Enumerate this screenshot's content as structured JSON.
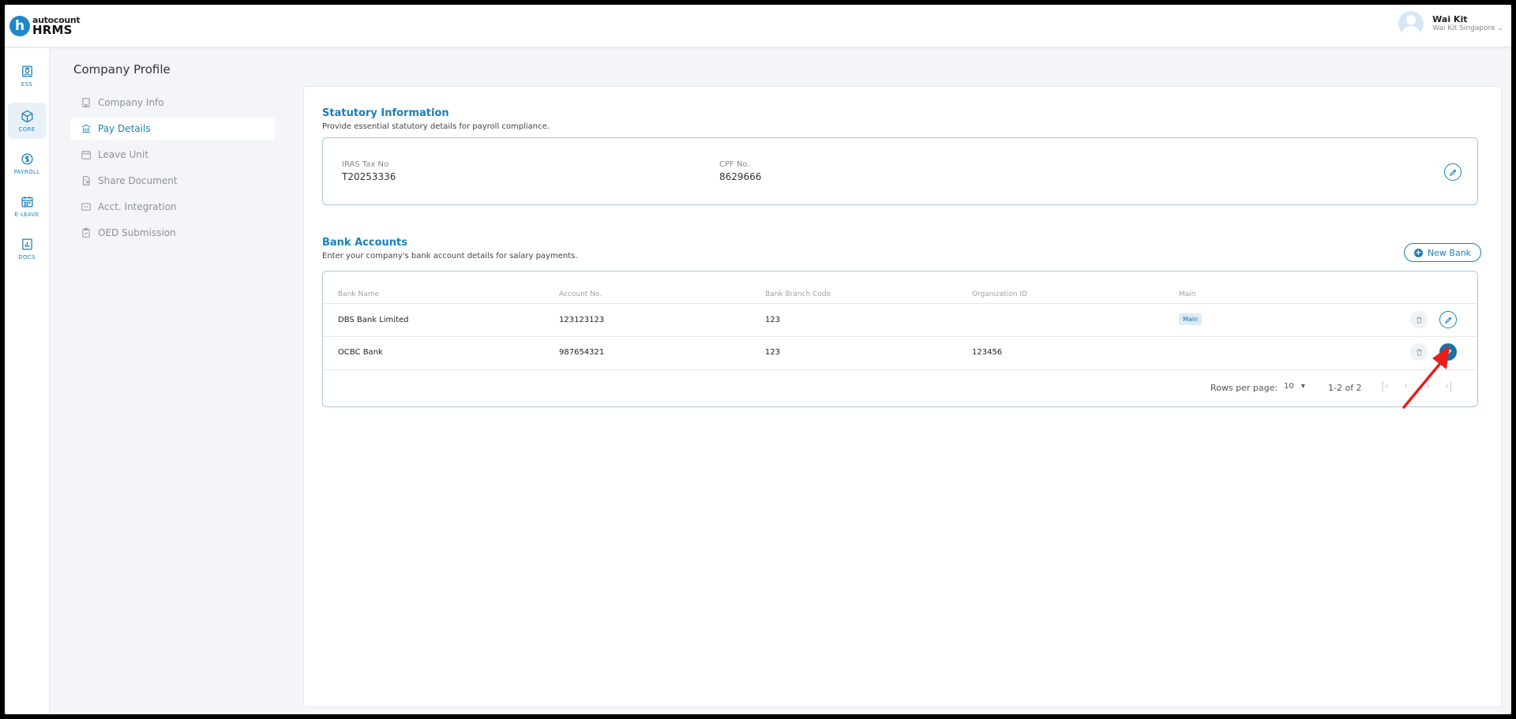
{
  "brand": {
    "logo_letter": "h",
    "logo_top": "autocount",
    "logo_bottom": "HRMS"
  },
  "user": {
    "name": "Wai Kit",
    "company": "Wai Kit Singapore"
  },
  "rail": [
    {
      "label": "ESS"
    },
    {
      "label": "CORE"
    },
    {
      "label": "PAYROLL"
    },
    {
      "label": "E-LEAVE"
    },
    {
      "label": "DOCS"
    }
  ],
  "page": {
    "title": "Company Profile"
  },
  "submenu": [
    {
      "label": "Company Info"
    },
    {
      "label": "Pay Details"
    },
    {
      "label": "Leave Unit"
    },
    {
      "label": "Share Document"
    },
    {
      "label": "Acct. Integration"
    },
    {
      "label": "OED Submission"
    }
  ],
  "statutory": {
    "title": "Statutory Information",
    "subtitle": "Provide essential statutory details for payroll compliance.",
    "iras_label": "IRAS Tax No",
    "iras_value": "T20253336",
    "cpf_label": "CPF No.",
    "cpf_value": "8629666"
  },
  "bank": {
    "title": "Bank Accounts",
    "subtitle": "Enter your company's bank account details for salary payments.",
    "new_button": "New Bank",
    "columns": [
      "Bank Name",
      "Account No.",
      "Bank Branch Code",
      "Organization ID",
      "Main"
    ],
    "rows": [
      {
        "bank_name": "DBS Bank Limited",
        "account_no": "123123123",
        "branch_code": "123",
        "org_id": "",
        "main": "Main"
      },
      {
        "bank_name": "OCBC Bank",
        "account_no": "987654321",
        "branch_code": "123",
        "org_id": "123456",
        "main": ""
      }
    ],
    "pagination": {
      "rows_per_page_label": "Rows per page:",
      "rows_per_page": "10",
      "range": "1-2 of 2"
    }
  },
  "colors": {
    "accent": "#1a7fb8",
    "annotation_arrow": "#e8201b"
  }
}
